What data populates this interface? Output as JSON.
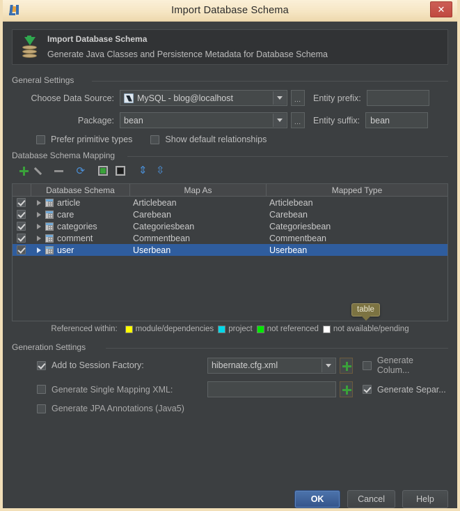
{
  "window": {
    "title": "Import Database Schema",
    "logo_icon": "intellij-idea-logo",
    "close_icon": "close-x-icon"
  },
  "banner": {
    "icon": "database-import-icon",
    "title": "Import Database Schema",
    "subtitle": "Generate Java Classes and Persistence Metadata for Database Schema"
  },
  "general_settings": {
    "legend": "General Settings",
    "data_source_label": "Choose Data Source:",
    "data_source_value": "MySQL - blog@localhost",
    "data_source_icon": "mysql-datasource-icon",
    "browse_label": "...",
    "entity_prefix_label": "Entity prefix:",
    "entity_prefix_value": "",
    "package_label": "Package:",
    "package_value": "bean",
    "entity_suffix_label": "Entity suffix:",
    "entity_suffix_value": "bean",
    "prefer_primitive_label": "Prefer primitive types",
    "prefer_primitive_checked": false,
    "show_default_rel_label": "Show default relationships",
    "show_default_rel_checked": false
  },
  "schema_mapping": {
    "legend": "Database Schema Mapping",
    "toolbar": [
      {
        "name": "add-button",
        "icon": "plus-icon"
      },
      {
        "name": "edit-button",
        "icon": "pencil-icon"
      },
      {
        "name": "remove-button",
        "icon": "minus-icon"
      },
      {
        "name": "refresh-button",
        "icon": "sync-icon"
      },
      {
        "name": "select-all-button",
        "icon": "checked-box-icon"
      },
      {
        "name": "deselect-all-button",
        "icon": "filled-box-icon"
      },
      {
        "name": "expand-all-button",
        "icon": "expand-all-icon"
      },
      {
        "name": "collapse-all-button",
        "icon": "collapse-all-icon"
      }
    ],
    "columns": [
      "",
      "Database Schema",
      "Map As",
      "Mapped Type"
    ],
    "rows": [
      {
        "checked": true,
        "name": "article",
        "map_as": "Articlebean",
        "mapped_type": "Articlebean",
        "selected": false
      },
      {
        "checked": true,
        "name": "care",
        "map_as": "Carebean",
        "mapped_type": "Carebean",
        "selected": false
      },
      {
        "checked": true,
        "name": "categories",
        "map_as": "Categoriesbean",
        "mapped_type": "Categoriesbean",
        "selected": false
      },
      {
        "checked": true,
        "name": "comment",
        "map_as": "Commentbean",
        "mapped_type": "Commentbean",
        "selected": false
      },
      {
        "checked": true,
        "name": "user",
        "map_as": "Userbean",
        "mapped_type": "Userbean",
        "selected": true
      }
    ],
    "tooltip": "table",
    "legend_row": {
      "prefix": "Referenced within:",
      "items": [
        {
          "label": "module/dependencies",
          "color": "#ffff00"
        },
        {
          "label": "project",
          "color": "#00d7e8"
        },
        {
          "label": "not referenced",
          "color": "#00e800"
        },
        {
          "label": "not available/pending",
          "color": "#ffffff"
        }
      ]
    }
  },
  "generation_settings": {
    "legend": "Generation Settings",
    "add_session_factory_label": "Add to Session Factory:",
    "add_session_factory_checked": true,
    "session_factory_value": "hibernate.cfg.xml",
    "generate_single_mapping_label": "Generate Single Mapping XML:",
    "generate_single_mapping_checked": false,
    "single_mapping_value": "",
    "generate_jpa_label": "Generate JPA Annotations (Java5)",
    "generate_jpa_checked": false,
    "generate_column_label": "Generate Colum...",
    "generate_column_checked": false,
    "generate_separate_label": "Generate Separ...",
    "generate_separate_checked": true,
    "add_icon": "plus-icon"
  },
  "buttons": {
    "ok": "OK",
    "cancel": "Cancel",
    "help": "Help"
  }
}
